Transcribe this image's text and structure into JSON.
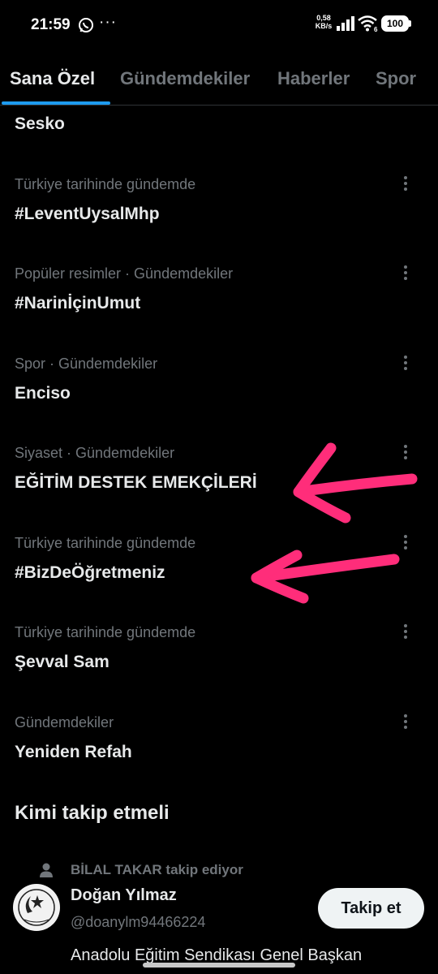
{
  "status_bar": {
    "time": "21:59",
    "more": "···",
    "net_speed_value": "0,58",
    "net_speed_unit": "KB/s",
    "network_type": "6",
    "battery": "100"
  },
  "tabs": [
    {
      "label": "Sana Özel",
      "active": true
    },
    {
      "label": "Gündemdekiler",
      "active": false
    },
    {
      "label": "Haberler",
      "active": false
    },
    {
      "label": "Spor",
      "active": false
    }
  ],
  "trends": {
    "first_title": "Sesko",
    "items": [
      {
        "meta": "Türkiye tarihinde gündemde",
        "title": "#LeventUysalMhp"
      },
      {
        "meta": "Popüler resimler · Gündemdekiler",
        "title": "#NarinİçinUmut"
      },
      {
        "meta": "Spor · Gündemdekiler",
        "title": "Enciso"
      },
      {
        "meta": "Siyaset · Gündemdekiler",
        "title": "EĞİTİM DESTEK EMEKÇİLERİ"
      },
      {
        "meta": "Türkiye tarihinde gündemde",
        "title": "#BizDeÖğretmeniz"
      },
      {
        "meta": "Türkiye tarihinde gündemde",
        "title": "Şevval Sam"
      },
      {
        "meta": "Gündemdekiler",
        "title": "Yeniden Refah"
      }
    ]
  },
  "who_to_follow": {
    "heading": "Kimi takip etmeli",
    "context": "BİLAL TAKAR takip ediyor",
    "user": {
      "name": "Doğan Yılmaz",
      "handle": "@doanylm94466224",
      "follow_label": "Takip et",
      "bio_line": "Anadolu Eğitim Sendikası Genel Başkan"
    }
  },
  "colors": {
    "background": "#000000",
    "text_primary": "#e7e9ea",
    "text_secondary": "#71767b",
    "accent": "#1d9bf0",
    "annotation_arrows": "#ff2d7a"
  }
}
